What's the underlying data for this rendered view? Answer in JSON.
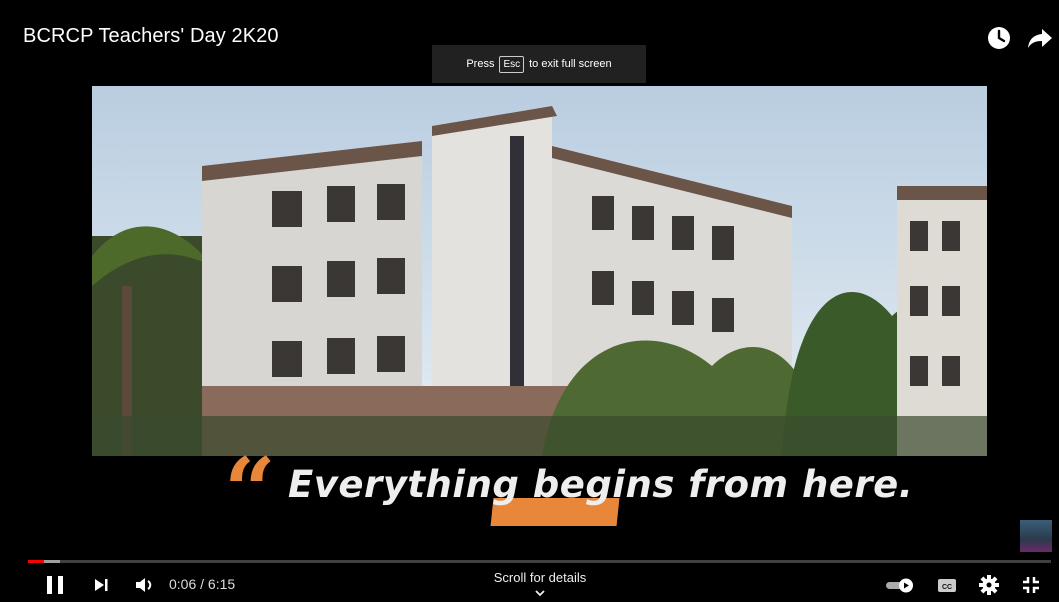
{
  "player": {
    "title": "BCRCP Teachers' Day 2K20",
    "esc_banner": {
      "before": "Press",
      "key": "Esc",
      "after": "to exit full screen"
    },
    "caption": {
      "text": "Everything begins from here.",
      "quote_color": "#e8873a"
    },
    "progress": {
      "played_fraction": 0.016,
      "current": "0:06",
      "duration": "6:15"
    },
    "time_display": "0:06 / 6:15",
    "scroll_hint": "Scroll for details",
    "icons": {
      "watch_later": "clock-icon",
      "share": "share-arrow-icon",
      "play_pause": "pause-icon",
      "next": "next-icon",
      "volume": "volume-icon",
      "autoplay": "autoplay-toggle-icon",
      "captions": "cc-icon",
      "settings": "gear-icon",
      "fullscreen": "exit-fullscreen-icon",
      "scroll": "chevron-down-icon"
    },
    "accent": "#ff0000"
  }
}
